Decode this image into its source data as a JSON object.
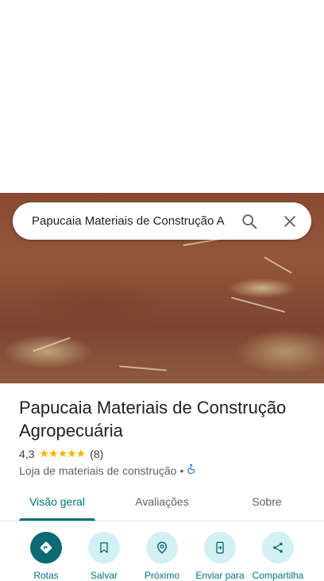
{
  "search": {
    "query": "Papucaia Materiais de Construção A"
  },
  "place": {
    "name": "Papucaia Materiais de Construção Agropecuária",
    "rating": "4,3",
    "stars": "★★★★★",
    "review_count": "(8)",
    "category": "Loja de materiais de construção",
    "separator": "•"
  },
  "tabs": [
    {
      "label": "Visão geral",
      "active": true
    },
    {
      "label": "Avaliações",
      "active": false
    },
    {
      "label": "Sobre",
      "active": false
    }
  ],
  "actions": [
    {
      "label": "Rotas",
      "icon": "directions-icon"
    },
    {
      "label": "Salvar",
      "icon": "bookmark-icon"
    },
    {
      "label": "Próximo",
      "icon": "nearby-icon"
    },
    {
      "label": "Enviar para",
      "icon": "send-to-phone-icon"
    },
    {
      "label": "Compartilha",
      "icon": "share-icon"
    }
  ],
  "colors": {
    "accent": "#01737a",
    "primary_button": "#0b6a73",
    "chip_bg": "#d3f0f3",
    "star": "#f4b400"
  }
}
